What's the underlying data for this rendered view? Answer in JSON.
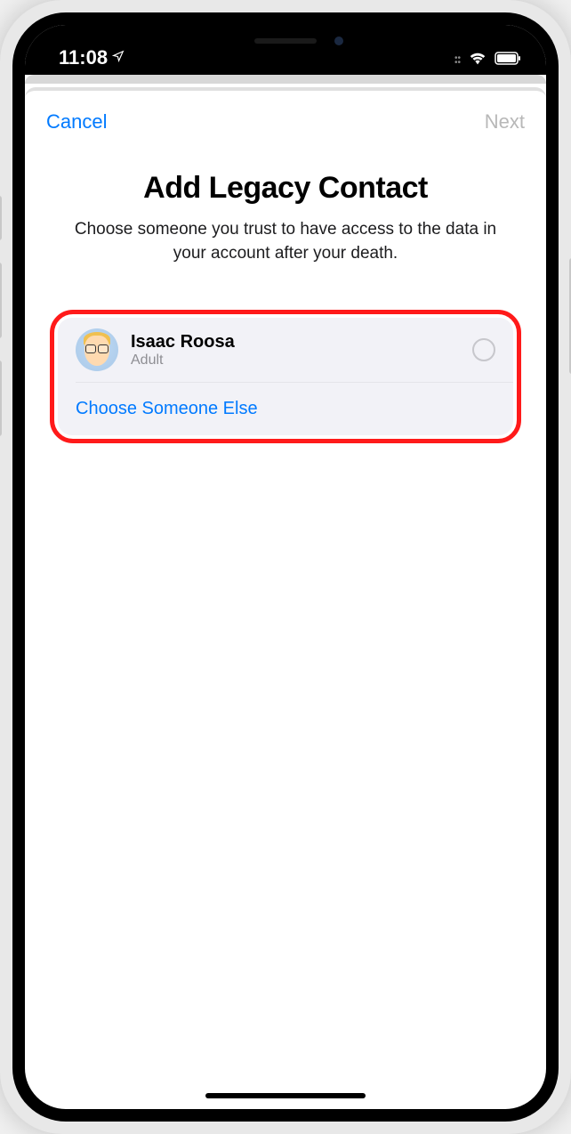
{
  "status_bar": {
    "time": "11:08",
    "location_indicator": "➤"
  },
  "nav": {
    "cancel_label": "Cancel",
    "next_label": "Next"
  },
  "page": {
    "title": "Add Legacy Contact",
    "subtitle": "Choose someone you trust to have access to the data in your account after your death."
  },
  "contact": {
    "name": "Isaac Roosa",
    "role": "Adult",
    "selected": false
  },
  "actions": {
    "choose_else_label": "Choose Someone Else"
  },
  "colors": {
    "accent": "#007aff",
    "disabled": "#b8b8b8",
    "highlight": "#ff1a1a"
  }
}
